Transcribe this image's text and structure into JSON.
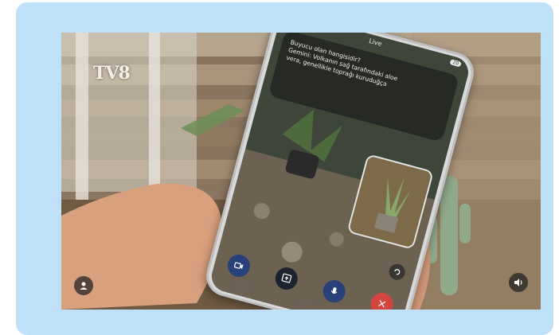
{
  "video": {
    "channel_logo": "TV8",
    "controls": {
      "user_icon": "person-icon",
      "volume_icon": "volume-icon"
    }
  },
  "phone": {
    "status_title": "Live",
    "status_badge": "20",
    "answer_lines": [
      "Buyucu olan hangisidir?",
      "Gemini: Volkanın sağ tarafındaki aloe",
      "vera, genellikle toprağı kuruduğça"
    ],
    "toolbar": {
      "camera_label": "",
      "screen_label": "",
      "mic_label": "",
      "close_label": "×"
    }
  },
  "colors": {
    "frame": "#bee0f8",
    "end_call": "#d3453f",
    "share_button": "#28417a"
  }
}
